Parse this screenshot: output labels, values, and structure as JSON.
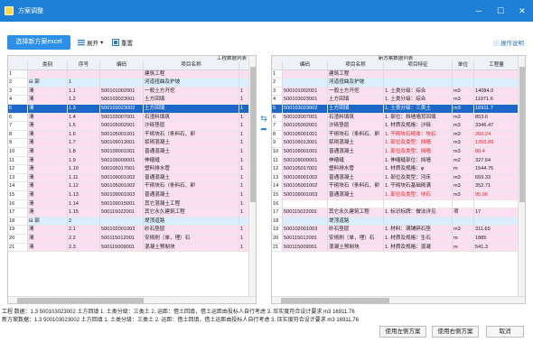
{
  "window": {
    "title": "方案调整",
    "controls": [
      "─",
      "☐",
      "✕"
    ]
  },
  "toolbar": {
    "primary": "选择新方案excel",
    "expand": "展开",
    "reset": "重置",
    "help": "操作说明"
  },
  "left": {
    "group_header": "工程数据列表",
    "headers": [
      "",
      "类别",
      "序号",
      "编码",
      "项目名称",
      ""
    ],
    "rows": [
      [
        "1",
        "",
        "",
        "",
        "建筑工程",
        "",
        "pink"
      ],
      [
        "2",
        "⊟ 部",
        "1",
        "",
        "河道扭曲及护坡",
        "",
        "lblue"
      ],
      [
        "3",
        "清",
        "1.1",
        "500101002001",
        "一般土方开挖",
        "1",
        "pink"
      ],
      [
        "4",
        "清",
        "1.2",
        "500103023001",
        "土方回填",
        "1",
        "pink"
      ],
      [
        "5",
        "清",
        "1.3",
        "500103023002",
        "土方回填",
        "1",
        "sel"
      ],
      [
        "6",
        "清",
        "1.4",
        "500103007001",
        "石渣料填筑",
        "1",
        "pink"
      ],
      [
        "7",
        "清",
        "1.5",
        "500105002001",
        "沙砾垫层",
        "1",
        "pink"
      ],
      [
        "8",
        "清",
        "1.6",
        "500105001001",
        "干砌块石（条料石、卵",
        "1",
        "pink"
      ],
      [
        "9",
        "清",
        "1.7",
        "500109013001",
        "浆砌混凝土",
        "1",
        "pink"
      ],
      [
        "10",
        "清",
        "1.8",
        "500109001001",
        "普通混凝土",
        "1",
        "pink"
      ],
      [
        "11",
        "清",
        "1.9",
        "500109009001",
        "伸缩缝",
        "1",
        "pink"
      ],
      [
        "12",
        "清",
        "1.10",
        "500105017001",
        "塑料排水管",
        "1",
        "pink"
      ],
      [
        "13",
        "清",
        "1.11",
        "500109001002",
        "普通混凝土",
        "1",
        "pink"
      ],
      [
        "14",
        "清",
        "1.12",
        "500105001002",
        "干砌块石（条料石、卵",
        "1",
        "pink"
      ],
      [
        "15",
        "清",
        "1.13",
        "500109001003",
        "普通混凝土",
        "1",
        "pink"
      ],
      [
        "16",
        "清",
        "1.14",
        "500109015001",
        "其它混凝土工程",
        "1",
        "pink"
      ],
      [
        "17",
        "清",
        "1.15",
        "500115022001",
        "其它永久建筑工程",
        "1",
        "pink"
      ],
      [
        "18",
        "⊟ 部",
        "2",
        "",
        "堤顶道路",
        "",
        "lblue"
      ],
      [
        "19",
        "清",
        "2.1",
        "500102001003",
        "砂石垫层",
        "1",
        "pink"
      ],
      [
        "20",
        "清",
        "2.2",
        "500115012001",
        "安砌刷（单，埋）石",
        "1",
        "pink"
      ],
      [
        "21",
        "清",
        "2.3",
        "500115009001",
        "混凝土预制块",
        "1",
        "pink"
      ]
    ]
  },
  "right": {
    "group_header": "新方案数据列表",
    "headers": [
      "",
      "编码",
      "项目名称",
      "项目特征",
      "单位",
      "工程量"
    ],
    "rows": [
      [
        "1",
        "",
        "建筑工程",
        "",
        "",
        "",
        "pink",
        ""
      ],
      [
        "2",
        "",
        "河道扭曲及护坡",
        "",
        "",
        "",
        "lblue",
        ""
      ],
      [
        "3",
        "500101002001",
        "一般土方开挖",
        "1. 土类分级：综合",
        "m3",
        "14084.0",
        "pink",
        ""
      ],
      [
        "4",
        "500103023001",
        "土方回填",
        "1. 土类分级：综合",
        "m3",
        "11971.6",
        "pink",
        ""
      ],
      [
        "5",
        "500103023002",
        "土方回填",
        "1. 土类分级：三类土",
        "m3",
        "16911.7",
        "sel",
        ""
      ],
      [
        "6",
        "500103007001",
        "石渣料填筑",
        "1. 部位：挡墙墙背回填",
        "m3",
        "853.6",
        "pink",
        ""
      ],
      [
        "7",
        "500105002001",
        "沙砾垫层",
        "1. 材质及规格：沙砾",
        "m3",
        "3346.47",
        "pink",
        ""
      ],
      [
        "8",
        "500105001001",
        "干砌块石（条料石、卵",
        "1. 干砌块石砌体：块石",
        "m3",
        "260.24",
        "pink",
        "red"
      ],
      [
        "9",
        "500109013001",
        "浆砌混凝土",
        "1. 部位及类型：挡墙",
        "m3",
        "1356.89",
        "pink",
        "red"
      ],
      [
        "10",
        "500109001001",
        "普通混凝土",
        "1. 部位及类型：挡墙",
        "m3",
        "80.4",
        "pink",
        "red"
      ],
      [
        "11",
        "500109009001",
        "伸缩缝",
        "1. 伸缩缝部位：挡墙",
        "m2",
        "327.64",
        "pink",
        ""
      ],
      [
        "12",
        "500105017001",
        "塑料排水管",
        "1. 材质及规格：φ",
        "m",
        "1544.75",
        "pink",
        ""
      ],
      [
        "13",
        "500109001002",
        "普通混凝土",
        "1. 部位及类型：河床",
        "m3",
        "659.33",
        "pink",
        ""
      ],
      [
        "14",
        "500105001002",
        "干砌块石（条料石、卵",
        "1. 干砌块石基础砌满",
        "m3",
        "352.71",
        "pink",
        ""
      ],
      [
        "15",
        "500109001003",
        "普通混凝土",
        "1. 部位及类型：块石",
        "m3",
        "95.06",
        "pink",
        "red"
      ],
      [
        "16",
        "",
        "",
        "",
        "",
        "",
        "",
        ""
      ],
      [
        "17",
        "500115022001",
        "其它永久建筑工程",
        "1. 标识标牌：做法详见",
        "项",
        "17",
        "pink",
        ""
      ],
      [
        "18",
        "",
        "堤顶道路",
        "",
        "",
        "",
        "lblue",
        ""
      ],
      [
        "19",
        "500102001003",
        "砂石垫层",
        "1. 材料：满铺碎石垫",
        "m3",
        "311.69",
        "pink",
        ""
      ],
      [
        "20",
        "500115012001",
        "安砌刷（单，埋）石",
        "1. 材质及规格：生石",
        "m",
        "1885",
        "pink",
        ""
      ],
      [
        "21",
        "500115009001",
        "混凝土预制块",
        "1. 材质及规格：混凝",
        "m",
        "541.3",
        "pink",
        ""
      ]
    ]
  },
  "status": {
    "line1": "工程 数据：1.3 500103023002 土方回填 1. 土类分级：三类土 2. 运距：借土回填，借土运距由投标人自行考虑 3. 压实度符合设计要求 m3 16911.76",
    "line2": "新方案数据：1.3 500103023002 土方回填 1. 土类分级：三类土 2. 运距：借土回填，借土运距由投标人自行考虑 3. 压实度符合设计要求 m3 16911.76"
  },
  "buttons": {
    "use_left": "使用左侧方案",
    "use_right": "使用右侧方案",
    "cancel": "取消"
  }
}
